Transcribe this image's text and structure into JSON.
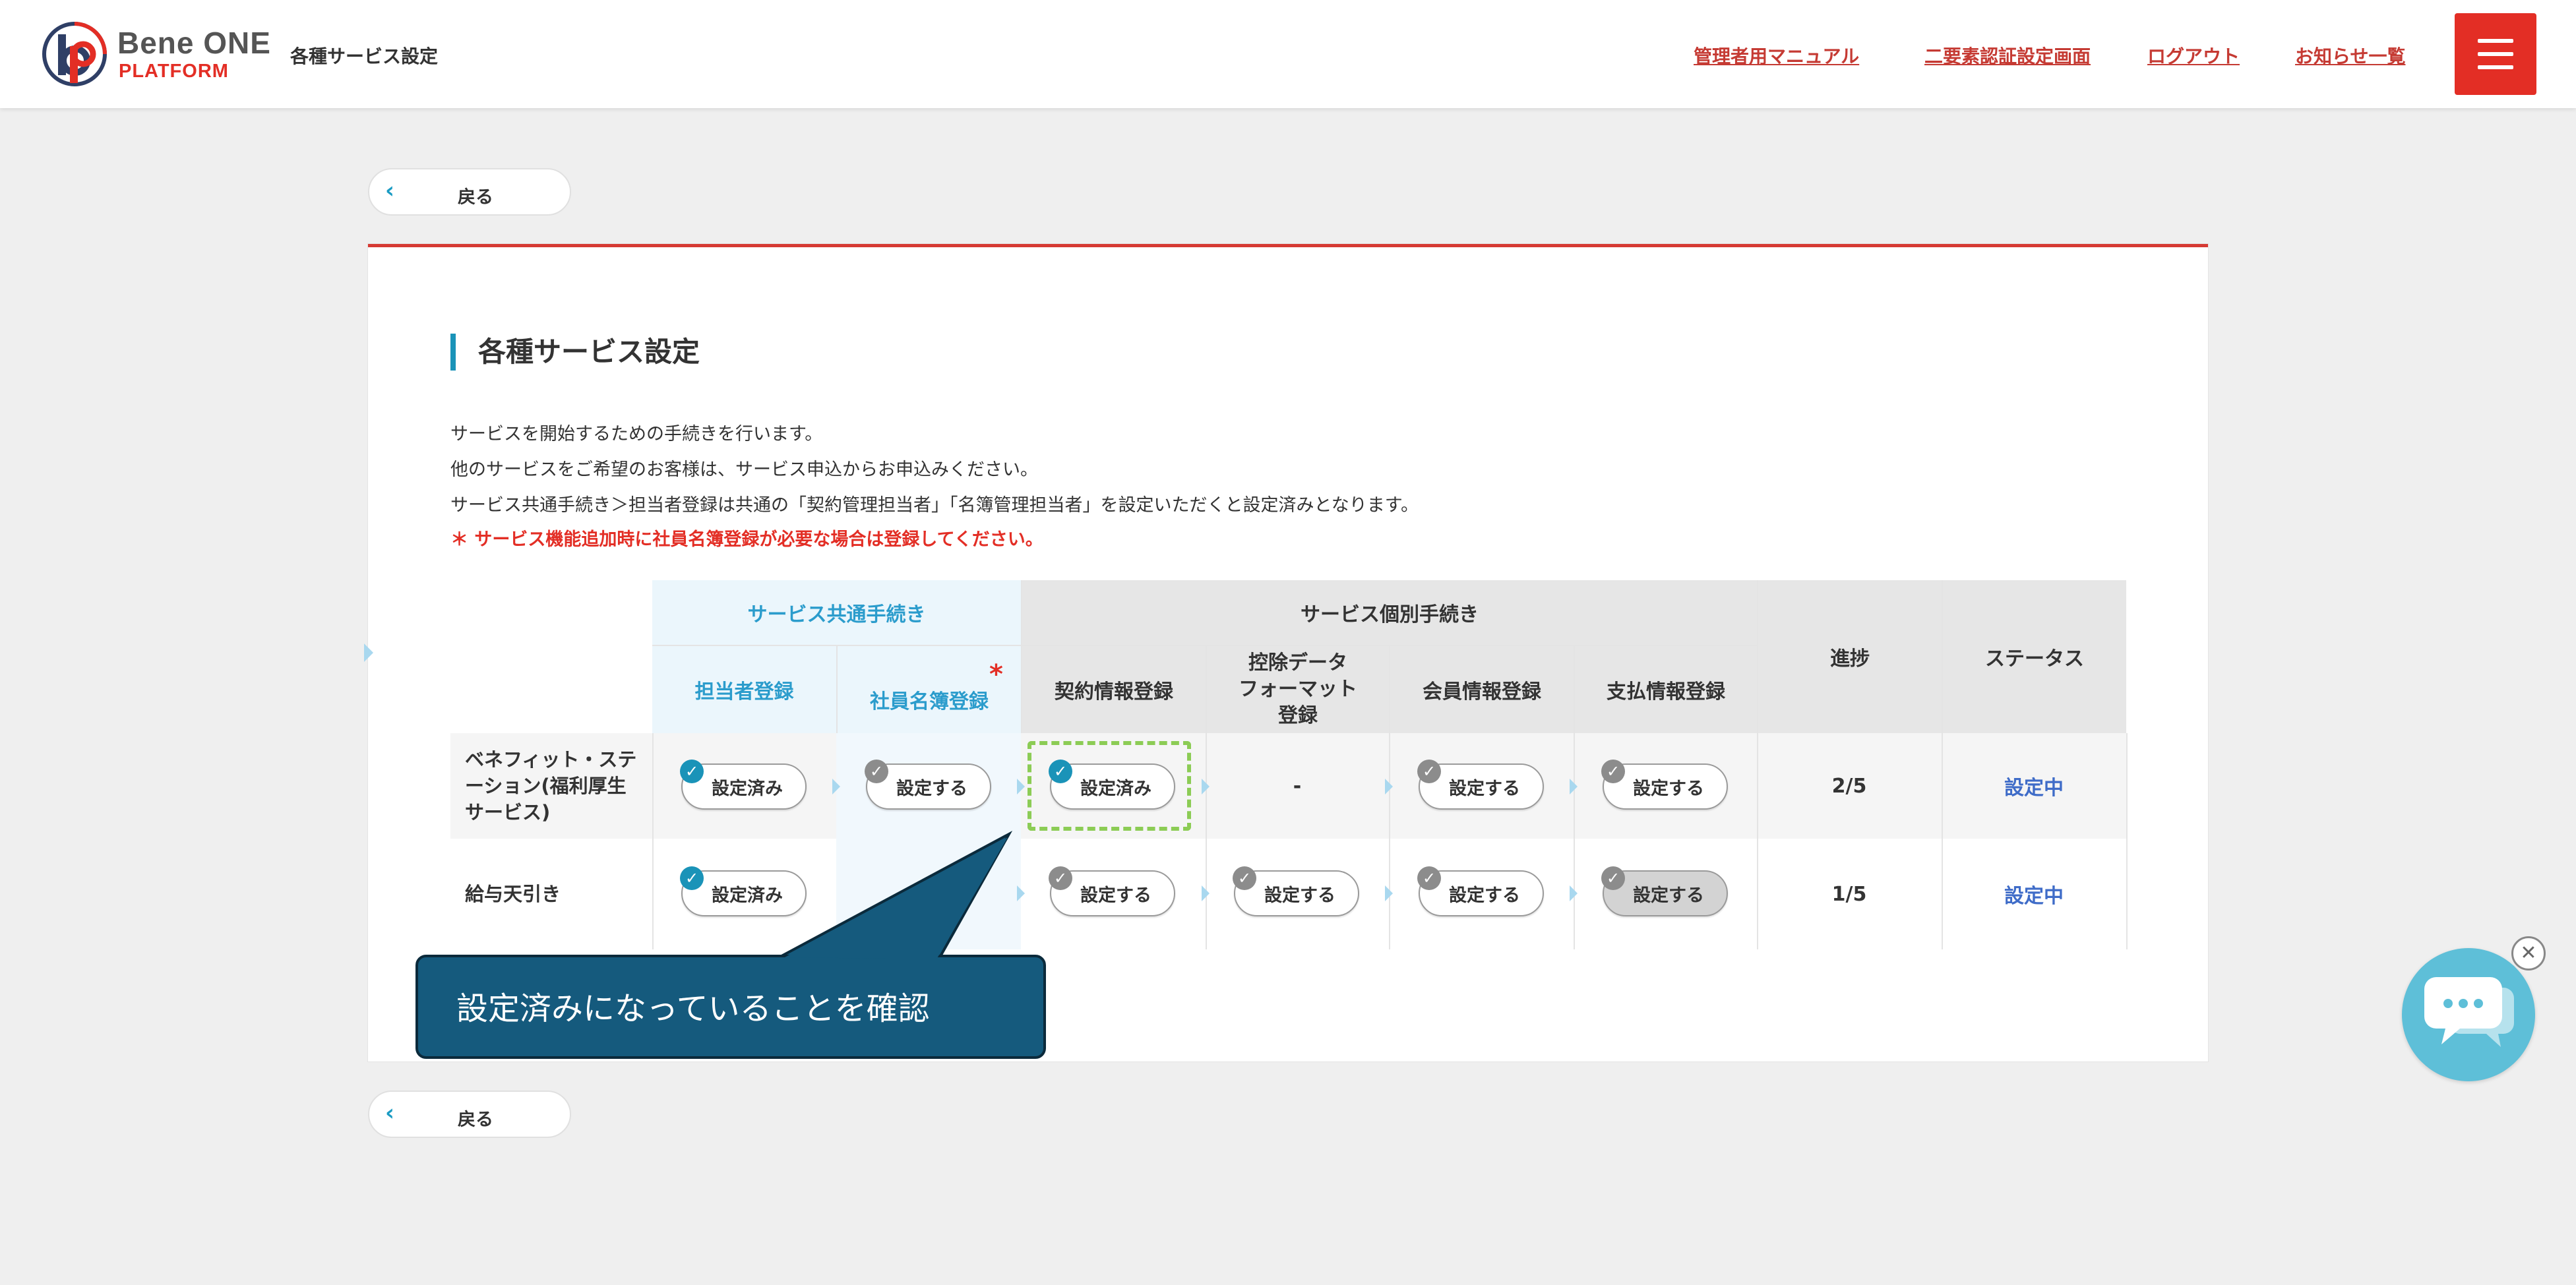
{
  "header": {
    "brand_name": "Bene ONE",
    "brand_sub": "PLATFORM",
    "title": "各種サービス設定",
    "links": [
      "管理者用マニュアル",
      "二要素認証設定画面",
      "ログアウト",
      "お知らせ一覧"
    ]
  },
  "back_label": "戻る",
  "page": {
    "title": "各種サービス設定",
    "descriptions": [
      "サービスを開始するための手続きを行います。",
      "他のサービスをご希望のお客様は、サービス申込からお申込みください。",
      "サービス共通手続き＞担当者登録は共通の「契約管理担当者」「名簿管理担当者」を設定いただくと設定済みとなります。"
    ],
    "note": "＊ サービス機能追加時に社員名簿登録が必要な場合は登録してください。"
  },
  "table": {
    "group_common": "サービス共通手続き",
    "group_individual": "サービス個別手続き",
    "columns": {
      "tantou": "担当者登録",
      "shain": "社員名簿登録",
      "required_mark": "*",
      "keiyaku": "契約情報登録",
      "koujo_l1": "控除データ",
      "koujo_l2": "フォーマット",
      "koujo_l3": "登録",
      "kaiin": "会員情報登録",
      "shiharai": "支払情報登録",
      "progress": "進捗",
      "status": "ステータス"
    },
    "rows": [
      {
        "label_l1": "ベネフィット・ステ",
        "label_l2": "ーション(福利厚生",
        "label_l3": "サービス)",
        "tantou": "設定済み",
        "shain": "設定する",
        "keiyaku": "設定済み",
        "koujo": "-",
        "kaiin": "設定する",
        "shiharai": "設定する",
        "progress": "2/5",
        "status": "設定中"
      },
      {
        "label": "給与天引き",
        "tantou": "設定済み",
        "keiyaku": "設定する",
        "koujo": "設定する",
        "kaiin": "設定する",
        "shiharai": "設定する",
        "progress": "1/5",
        "status": "設定中"
      }
    ]
  },
  "callout": {
    "text": "設定済みになっていることを確認"
  },
  "colors": {
    "accent_red": "#e32e25",
    "accent_blue": "#1a93b8",
    "callout_bg": "#155a7d",
    "chat_bg": "#5ebfd8"
  },
  "icons": [
    "logo-mark",
    "hamburger-menu-icon",
    "chevron-left-icon",
    "check-circle-icon",
    "chat-bubbles-icon",
    "close-icon"
  ]
}
